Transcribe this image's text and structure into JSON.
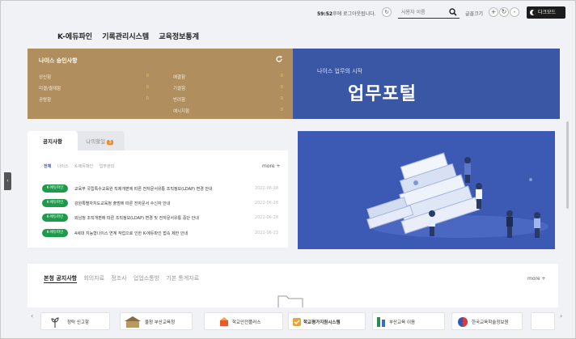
{
  "topbar": {
    "time": "59:52",
    "timer_suffix": "후에 로그아웃됩니다.",
    "search_placeholder": "사용자 이름",
    "font_size_label": "글꼴크기",
    "plus": "+",
    "minus": "-",
    "dark_mode": "다크모드"
  },
  "nav": {
    "items": [
      "K-에듀파인",
      "기록관리시스템",
      "교육정보통계"
    ]
  },
  "approval": {
    "title": "나이스 승인사항",
    "left_rows": [
      {
        "label": "상신함",
        "value": "0"
      },
      {
        "label": "미결/결재함",
        "value": "0"
      },
      {
        "label": "공람함",
        "value": "0"
      }
    ],
    "right_rows": [
      {
        "label": "예결함",
        "value": "0"
      },
      {
        "label": "기결함",
        "value": "0"
      },
      {
        "label": "반려함",
        "value": "0"
      },
      {
        "label": "예시지함",
        "value": "0"
      }
    ]
  },
  "portal": {
    "subtitle": "나이스 업무의 시작",
    "title": "업무포털"
  },
  "notice": {
    "tabs": [
      {
        "label": "공지사항"
      },
      {
        "label": "나의할일",
        "badge": "3"
      }
    ],
    "subtabs": [
      "전체",
      "나이스",
      "K-에듀파인",
      "업무관리"
    ],
    "more": "more +",
    "items": [
      {
        "tag": "K-에듀파인",
        "text": "교육부 국립특수교육원 직제개편에 따른 전자문서유통 조직정보(LDAP) 변경 안내",
        "date": "2022-06-28"
      },
      {
        "tag": "K-에듀파인",
        "text": "강원특별자치도교육청 출범에 따른 전자문서 수신자 안내",
        "date": "2022-06-28"
      },
      {
        "tag": "K-에듀파인",
        "text": "외남청 조직개편에 따른 조직정보(LDAP) 변경 및 전자문서유통 중단 안내",
        "date": "2022-06-28"
      },
      {
        "tag": "K-에듀파인",
        "text": "4세대 지능형나이스 연계 작업으로 인한 K-에듀파인 접속 제한 안내",
        "date": "2022-06-23"
      }
    ]
  },
  "hq": {
    "tabs": [
      "본청 공지사항",
      "회의자료",
      "정조사",
      "업업소통방",
      "기본 통계자료"
    ],
    "more": "more +"
  },
  "banners": [
    {
      "label": "청탁 신고함"
    },
    {
      "label": "울청 부산교육청"
    },
    {
      "label": "학교안전플러스"
    },
    {
      "label": "학교평가지원시스템"
    },
    {
      "label": "부산교육 이음"
    },
    {
      "label": "한국교육학술정보원"
    },
    {
      "label": ""
    }
  ],
  "colors": {
    "approval_bg": "#b08e5e",
    "portal_bg": "#3a57a5",
    "notice_tag": "#1e9a4c",
    "badge": "#f08a24"
  }
}
